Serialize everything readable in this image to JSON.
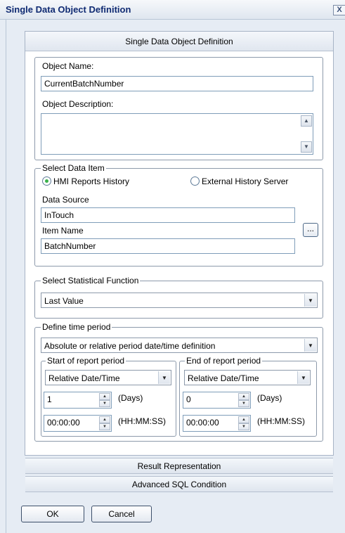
{
  "window": {
    "title": "Single Data Object Definition",
    "close_glyph": "X"
  },
  "panel": {
    "header": "Single Data Object Definition"
  },
  "object": {
    "name_label": "Object Name:",
    "name_value": "CurrentBatchNumber",
    "description_label": "Object Description:",
    "description_value": ""
  },
  "data_item": {
    "legend": "Select Data Item",
    "radio_hmi": "HMI Reports History",
    "radio_external": "External History Server",
    "selected": "HMI Reports History",
    "data_source_label": "Data Source",
    "data_source_value": "InTouch",
    "item_name_label": "Item Name",
    "item_name_value": "BatchNumber",
    "browse_label": "..."
  },
  "statistical": {
    "legend": "Select Statistical Function",
    "value": "Last Value"
  },
  "time_period": {
    "legend": "Define time period",
    "definition_value": "Absolute or relative period date/time definition",
    "start": {
      "legend": "Start of report period",
      "mode": "Relative Date/Time",
      "days_value": "1",
      "days_unit": "(Days)",
      "time_value": "00:00:00",
      "time_unit": "(HH:MM:SS)"
    },
    "end": {
      "legend": "End of report period",
      "mode": "Relative Date/Time",
      "days_value": "0",
      "days_unit": "(Days)",
      "time_value": "00:00:00",
      "time_unit": "(HH:MM:SS)"
    }
  },
  "sections": {
    "result_representation": "Result Representation",
    "advanced_sql": "Advanced SQL Condition"
  },
  "buttons": {
    "ok": "OK",
    "cancel": "Cancel"
  }
}
